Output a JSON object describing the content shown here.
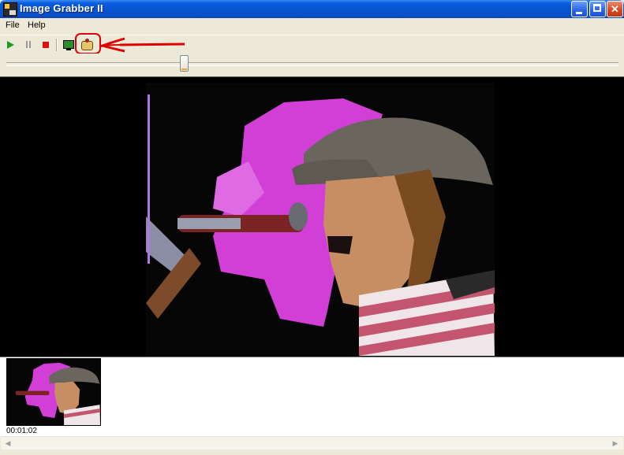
{
  "window": {
    "title": "Image Grabber II"
  },
  "menu": {
    "items": [
      "File",
      "Help"
    ]
  },
  "toolbar": {
    "buttons": [
      "play-icon",
      "pause-icon",
      "stop-icon",
      "monitor-icon",
      "grab-frame-icon"
    ],
    "annotation_color": "#e00000"
  },
  "slider": {
    "position_fraction": 0.29
  },
  "thumbnails": [
    {
      "time": "00:01:02"
    }
  ],
  "colors": {
    "titlebar": "#0a5bdc",
    "accent": "#e00000",
    "window_bg": "#ece9d8"
  }
}
